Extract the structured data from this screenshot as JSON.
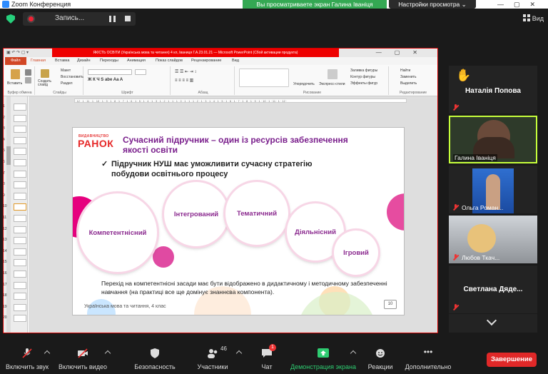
{
  "app": {
    "title": "Zoom Конференция",
    "share_banner": "Вы просматриваете экран Галина Іваніця",
    "view_options": "Настройки просмотра ⌄"
  },
  "top_toolbar": {
    "recording_label": "Запись...",
    "view_label": "Вид"
  },
  "ppt": {
    "window_title": "ЯКІСТЬ ОСВІТИ (Українська мова та читання) 4 кл, Іваниця Г.А.23.01.21 — Microsoft PowerPoint (Сбой активации продукта)",
    "tabs": [
      "Файл",
      "Главная",
      "Вставка",
      "Дизайн",
      "Переходы",
      "Анимация",
      "Показ слайдов",
      "Рецензирование",
      "Вид"
    ],
    "ribbon": {
      "paste": "Вставить",
      "create_slide": "Создать слайд",
      "layout": "Макет",
      "restore": "Восстановить",
      "section": "Раздел",
      "arrange": "Упорядочить",
      "express_styles": "Экспресс-стили",
      "shape_fill": "Заливка фигуры",
      "shape_outline": "Контур фигуры",
      "shape_effects": "Эффекты фигур",
      "find": "Найти",
      "replace": "Заменить",
      "select": "Выделить",
      "groups": [
        "Буфер обмена",
        "Слайды",
        "Шрифт",
        "Абзац",
        "Рисование",
        "Редактирование"
      ]
    },
    "slide_numbers": [
      "1",
      "2",
      "3",
      "4",
      "5",
      "6",
      "7",
      "8",
      "9",
      "10",
      "11",
      "12",
      "13",
      "14",
      "15",
      "16",
      "17",
      "18",
      "19",
      "20"
    ],
    "selected_slide": 10,
    "ruler": "· 12 · 1 · 11 · 1 · 10 · 1 · 9 · 1 · 8 · 1 · 7 · 1 · 6 · 1 · 5 · 1 · 4 · 1 · 3 · 1 · 2 · 1 · 1 · 1 · 0 · 1 · 1 · 1 · 2 · 1 · 3 · 1 · 4 · 1 · 5 · 1 · 6 · 1 · 7 · 1 · 8 · 1 · 9 · 1 · 10 · 1 · 11 · 1 · 12 ·"
  },
  "slide": {
    "brand_small": "ВИДАВНИЦТВО",
    "brand_big": "РАНОК",
    "title": "Сучасний підручник – один із ресурсів забезпечення якості освіти",
    "bullet_check": "✓",
    "bullet": "Підручник НУШ має уможливити сучасну стратегію побудови освітнього процесу",
    "circles": [
      "Компетентнісний",
      "Інтегрований",
      "Тематичний",
      "Діяльнісний",
      "Ігровий"
    ],
    "footer_text": "Перехід на компетентнісні засади має бути відображено в дидактичному і методичному забезпеченні навчання (на практиці все ще домінує знаннєва компонента).",
    "footer_link": "Українська мова та читання, 4 клас",
    "page": "10"
  },
  "participants": [
    {
      "name": "Наталія Попова",
      "hand": "✋"
    },
    {
      "name": "Галина Іваніця"
    },
    {
      "name": "Ольга Роман..."
    },
    {
      "name": "Любов Ткач..."
    },
    {
      "name": "Светлана Дяде..."
    }
  ],
  "bottom_toolbar": {
    "mute": "Включить звук",
    "video": "Включить видео",
    "security": "Безопасность",
    "participants": "Участники",
    "participants_count": "46",
    "chat": "Чат",
    "chat_badge": "1",
    "share": "Демонстрация экрана",
    "reactions": "Реакции",
    "more": "Дополнительно",
    "end": "Завершение"
  },
  "colors": {
    "share_green": "#34a853",
    "end_red": "#e02828",
    "active_speaker": "#c6ff3b",
    "slide_title": "#7a1f8c"
  }
}
